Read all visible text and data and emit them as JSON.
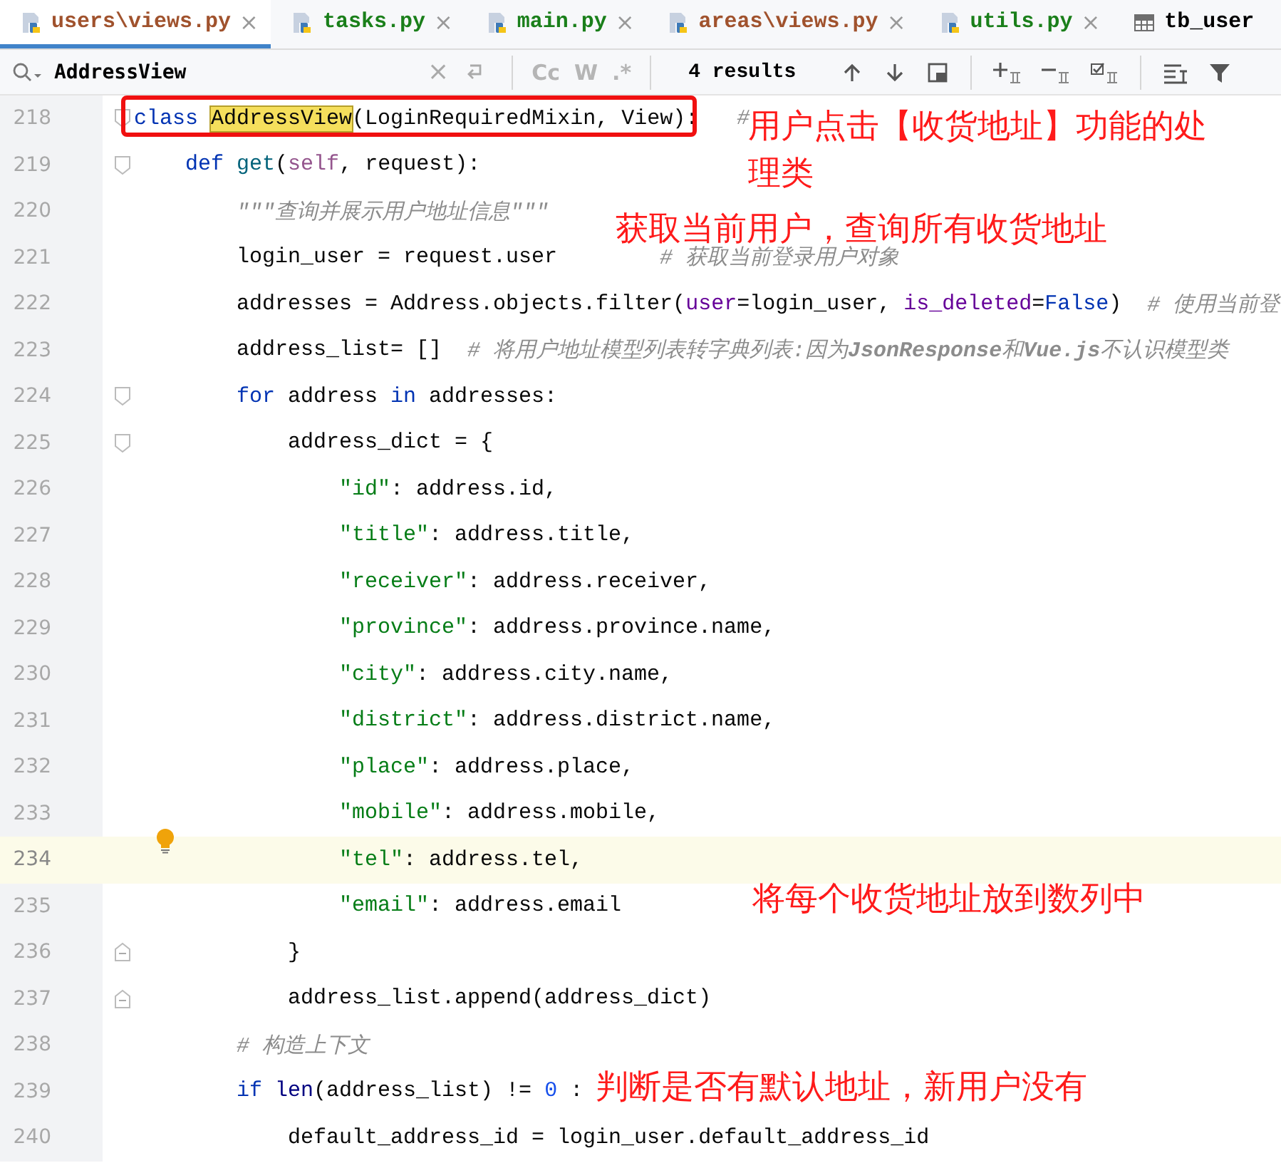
{
  "tabs": [
    {
      "label": "users\\views.py",
      "kind": "python",
      "color": "#a0522d",
      "selected": true,
      "close": "×"
    },
    {
      "label": "tasks.py",
      "kind": "python",
      "color": "#1a7f1a",
      "selected": false,
      "close": "×"
    },
    {
      "label": "main.py",
      "kind": "python",
      "color": "#1a7f1a",
      "selected": false,
      "close": "×"
    },
    {
      "label": "areas\\views.py",
      "kind": "python",
      "color": "#a0522d",
      "selected": false,
      "close": "×"
    },
    {
      "label": "utils.py",
      "kind": "python",
      "color": "#1a7f1a",
      "selected": false,
      "close": "×"
    },
    {
      "label": "tb_user",
      "kind": "table",
      "color": "#000000",
      "selected": false
    }
  ],
  "search": {
    "value": "AddressView",
    "clear": "×",
    "options": [
      {
        "label": "Cc",
        "selected": false
      },
      {
        "label": "W",
        "selected": false
      },
      {
        "label": ".*",
        "selected": false
      }
    ],
    "results": "4 results"
  },
  "lines": [
    {
      "number": "218",
      "fold": {
        "kind": "start"
      },
      "tokens": [
        {
          "kind": "kw",
          "t": "class"
        },
        {
          "kind": "match",
          "t": " AddressView"
        },
        {
          "kind": "plain",
          "t": "(LoginRequiredMixin, View):"
        },
        {
          "kind": "comment",
          "t": "   #"
        }
      ]
    },
    {
      "number": "219",
      "fold": {
        "kind": "start"
      },
      "tokens": [
        {
          "kind": "kw",
          "t": "    def"
        },
        {
          "kind": "fn",
          "t": " get"
        },
        {
          "kind": "plain",
          "t": "("
        },
        {
          "kind": "self",
          "t": "self"
        },
        {
          "kind": "plain",
          "t": ", request):"
        }
      ]
    },
    {
      "number": "220",
      "tokens": [
        {
          "kind": "doc",
          "t": "        \"\"\"查询并展示用户地址信息\"\"\""
        }
      ]
    },
    {
      "number": "221",
      "tokens": [
        {
          "kind": "plain",
          "t": "        login_user = request.user"
        },
        {
          "kind": "comment",
          "t": "        # 获取当前登录用户对象"
        }
      ]
    },
    {
      "number": "222",
      "tokens": [
        {
          "kind": "plain",
          "t": "        addresses = Address.objects.filter("
        },
        {
          "kind": "param",
          "t": "user"
        },
        {
          "kind": "plain",
          "t": "=login_user, "
        },
        {
          "kind": "param",
          "t": "is_deleted"
        },
        {
          "kind": "plain",
          "t": "="
        },
        {
          "kind": "kw",
          "t": "False"
        },
        {
          "kind": "plain",
          "t": ")"
        },
        {
          "kind": "comment",
          "t": "  # 使用当前登"
        }
      ]
    },
    {
      "number": "223",
      "tokens": [
        {
          "kind": "plain",
          "t": "        address_list= []"
        },
        {
          "kind": "comment",
          "t": "  # 将用户地址模型列表转字典列表:因为**JsonResponse**和**Vue.js**不认识模型类"
        }
      ]
    },
    {
      "number": "224",
      "fold": {
        "kind": "start"
      },
      "tokens": [
        {
          "kind": "kw",
          "t": "        for"
        },
        {
          "kind": "plain",
          "t": " address "
        },
        {
          "kind": "kw",
          "t": "in"
        },
        {
          "kind": "plain",
          "t": " addresses:"
        }
      ]
    },
    {
      "number": "225",
      "fold": {
        "kind": "start"
      },
      "tokens": [
        {
          "kind": "plain",
          "t": "            address_dict = {"
        }
      ]
    },
    {
      "number": "226",
      "tokens": [
        {
          "kind": "str",
          "t": "                \"id\""
        },
        {
          "kind": "plain",
          "t": ": address.id,"
        }
      ]
    },
    {
      "number": "227",
      "tokens": [
        {
          "kind": "str",
          "t": "                \"title\""
        },
        {
          "kind": "plain",
          "t": ": address.title,"
        }
      ]
    },
    {
      "number": "228",
      "tokens": [
        {
          "kind": "str",
          "t": "                \"receiver\""
        },
        {
          "kind": "plain",
          "t": ": address.receiver,"
        }
      ]
    },
    {
      "number": "229",
      "tokens": [
        {
          "kind": "str",
          "t": "                \"province\""
        },
        {
          "kind": "plain",
          "t": ": address.province.name,"
        }
      ]
    },
    {
      "number": "230",
      "tokens": [
        {
          "kind": "str",
          "t": "                \"city\""
        },
        {
          "kind": "plain",
          "t": ": address.city.name,"
        }
      ]
    },
    {
      "number": "231",
      "tokens": [
        {
          "kind": "str",
          "t": "                \"district\""
        },
        {
          "kind": "plain",
          "t": ": address.district.name,"
        }
      ]
    },
    {
      "number": "232",
      "tokens": [
        {
          "kind": "str",
          "t": "                \"place\""
        },
        {
          "kind": "plain",
          "t": ": address.place,"
        }
      ]
    },
    {
      "number": "233",
      "tokens": [
        {
          "kind": "str",
          "t": "                \"mobile\""
        },
        {
          "kind": "plain",
          "t": ": address.mobile,"
        }
      ]
    },
    {
      "number": "234",
      "current": true,
      "hint": true,
      "tokens": [
        {
          "kind": "str",
          "t": "                \"tel\""
        },
        {
          "kind": "plain",
          "t": ": address.tel,"
        }
      ]
    },
    {
      "number": "235",
      "tokens": [
        {
          "kind": "str",
          "t": "                \"email\""
        },
        {
          "kind": "plain",
          "t": ": address.email"
        }
      ]
    },
    {
      "number": "236",
      "fold": {
        "kind": "end"
      },
      "tokens": [
        {
          "kind": "plain",
          "t": "            }"
        }
      ]
    },
    {
      "number": "237",
      "fold": {
        "kind": "end"
      },
      "tokens": [
        {
          "kind": "plain",
          "t": "            address_list.append(address_dict)"
        }
      ]
    },
    {
      "number": "238",
      "tokens": [
        {
          "kind": "comment",
          "t": "        # 构造上下文"
        }
      ]
    },
    {
      "number": "239",
      "tokens": [
        {
          "kind": "kw",
          "t": "        if"
        },
        {
          "kind": "builtin",
          "t": " len"
        },
        {
          "kind": "plain",
          "t": "(address_list) != "
        },
        {
          "kind": "num",
          "t": "0"
        },
        {
          "kind": "plain",
          "t": " :"
        }
      ]
    },
    {
      "number": "240",
      "tokens": [
        {
          "kind": "plain",
          "t": "            default_address_id = login_user.default_address_id"
        }
      ]
    }
  ],
  "annotations": [
    "用户点击【收货地址】功能的处理类",
    "获取当前用户，查询所有收货地址",
    "将每个收货地址放到数列中",
    "判断是否有默认地址，新用户没有"
  ]
}
